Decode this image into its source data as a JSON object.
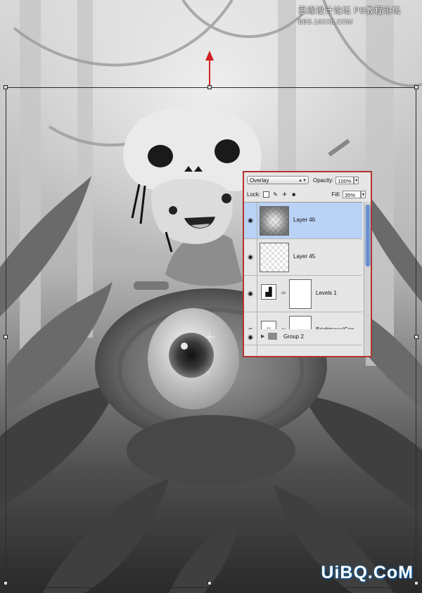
{
  "watermark": {
    "top_cn": "思缘设计论坛",
    "top_ps": "PS教程论坛",
    "top_url": "BBS.16XX8.COM",
    "bottom": "UiBQ.CoM"
  },
  "layers_panel": {
    "blend_mode": "Overlay",
    "opacity_label": "Opacity:",
    "opacity_value": "100%",
    "lock_label": "Lock:",
    "fill_label": "Fill:",
    "fill_value": "35%",
    "layers": [
      {
        "name": "Layer 46",
        "selected": true
      },
      {
        "name": "Layer 45",
        "selected": false
      },
      {
        "name": "Levels 1",
        "type": "levels-adjustment"
      },
      {
        "name": "Brightness/Con...",
        "type": "brightness-adjustment"
      }
    ],
    "group_name": "Group 2"
  },
  "colors": {
    "panel_border": "#b0342e",
    "selected_row": "#b9d2f5",
    "arrow": "#d21f1f"
  }
}
